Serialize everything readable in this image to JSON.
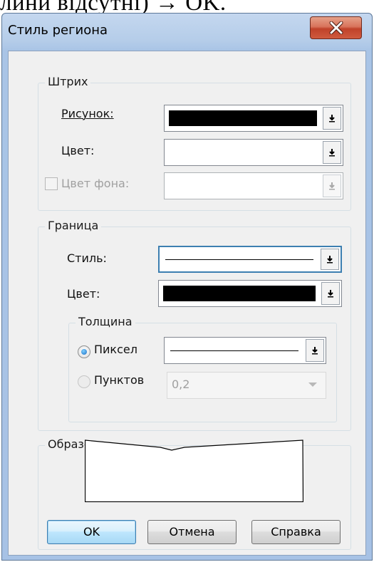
{
  "background_text": "лини відсутні) → OK.",
  "dialog": {
    "title": "Стиль региона",
    "close_icon": "close-x-icon",
    "accent_color": "#3c7fb1"
  },
  "stroke_group": {
    "title": "Штрих",
    "pattern_label": "Рисунок:",
    "pattern_swatch_color": "#000000",
    "color_label": "Цвет:",
    "color_swatch_color": "#ffffff",
    "bg_color_label": "Цвет фона:",
    "bg_color_checked": false
  },
  "border_group": {
    "title": "Граница",
    "style_label": "Стиль:",
    "color_label": "Цвет:",
    "color_swatch_color": "#000000",
    "thickness": {
      "title": "Толщина",
      "pixel_label": "Пиксел",
      "points_label": "Пунктов",
      "points_value": "0,2",
      "selected": "pixel"
    }
  },
  "sample_group": {
    "title": "Образец"
  },
  "buttons": {
    "ok": "OK",
    "cancel": "Отмена",
    "help": "Справка"
  }
}
